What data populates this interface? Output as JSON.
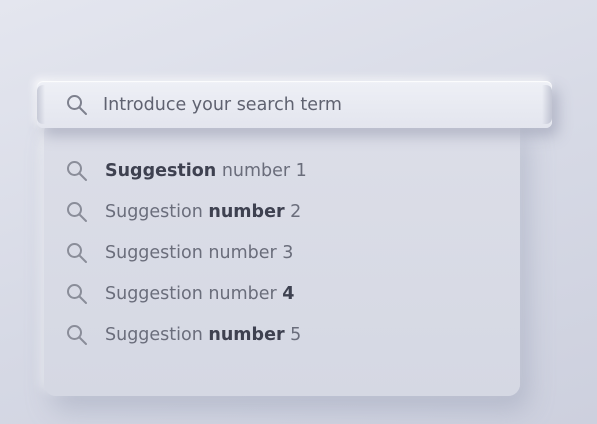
{
  "search": {
    "placeholder": "Introduce your search term",
    "icon": "search-icon"
  },
  "suggestions": [
    {
      "bold": "Suggestion",
      "text": " number 1"
    },
    {
      "pre": "Suggestion ",
      "bold": "number",
      "text": " 2"
    },
    {
      "pre": "Suggestion number 3"
    },
    {
      "pre": "Suggestion number ",
      "bold": "4"
    },
    {
      "pre": "Suggestion ",
      "bold": "number",
      "text": " 5"
    }
  ],
  "colors": {
    "background": "#dadce7",
    "text": "#6a6d7b",
    "text_bold": "#3e4150",
    "icon": "#8a8d99"
  }
}
